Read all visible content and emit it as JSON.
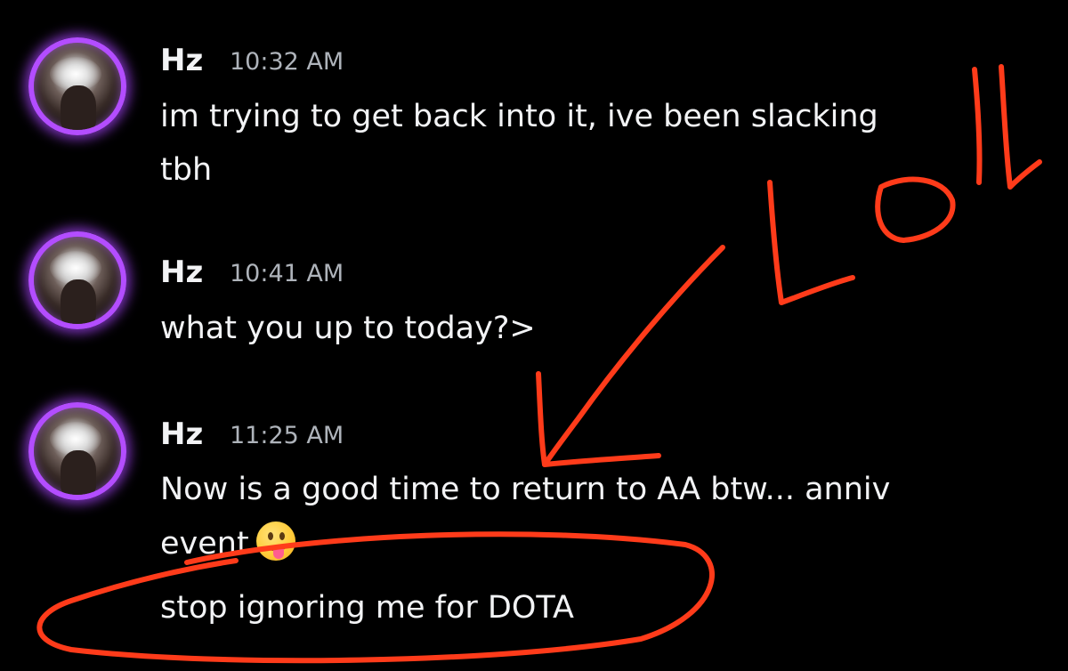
{
  "messages": [
    {
      "username": "Hz",
      "timestamp": "10:32 AM",
      "lines": [
        "im trying to get back into it, ive been slacking",
        "tbh"
      ]
    },
    {
      "username": "Hz",
      "timestamp": "10:41 AM",
      "lines": [
        "what you up to today?>"
      ]
    },
    {
      "username": "Hz",
      "timestamp": "11:25 AM",
      "lines": [
        "Now is a good time to return to AA btw... anniv",
        "event",
        "stop ignoring me for DOTA"
      ],
      "emoji": "tongue-out-emoji"
    }
  ],
  "colors": {
    "background": "#000000",
    "text": "#f2f3f5",
    "timestamp": "#aeb3ba",
    "avatar_ring": "#b34dff",
    "annotation": "#ff3b1a"
  }
}
